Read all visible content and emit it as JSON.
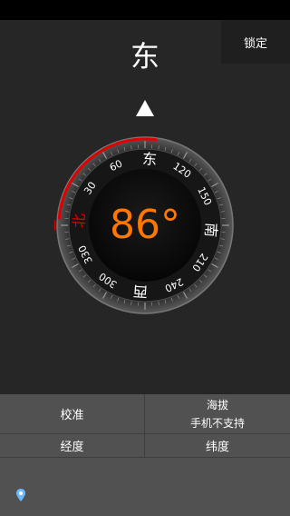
{
  "header": {
    "direction": "东",
    "lock_label": "锁定"
  },
  "compass": {
    "heading": 86,
    "degree_text": "86°",
    "north_label": "北",
    "east_label": "东",
    "south_label": "南",
    "west_label": "西",
    "tick_labels": [
      "30",
      "60",
      "120",
      "150",
      "210",
      "240",
      "300",
      "330"
    ],
    "accent_color": "#ff7700",
    "north_color": "#e00000"
  },
  "info": {
    "calibrate_label": "校准",
    "altitude_label": "海拔",
    "altitude_value": "手机不支持",
    "longitude_label": "经度",
    "latitude_label": "纬度"
  },
  "icons": {
    "pointer": "up-triangle-icon",
    "location": "location-pin-icon"
  }
}
